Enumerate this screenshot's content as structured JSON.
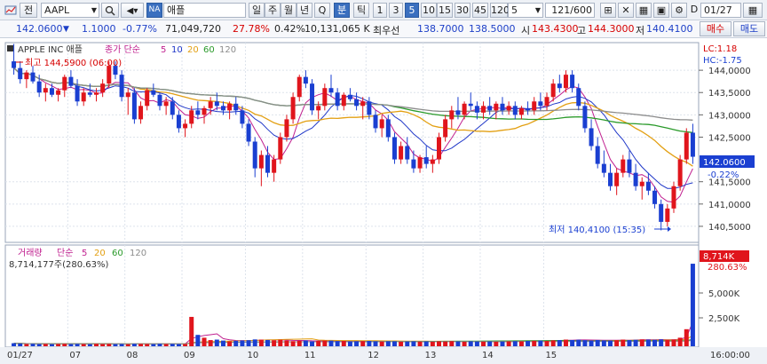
{
  "toolbar": {
    "mode_label": "전",
    "symbol": "AAPL",
    "market_badge": "NA",
    "stock_name": "애플",
    "periods": [
      "일",
      "주",
      "월",
      "년",
      "Q",
      "분",
      "틱"
    ],
    "active_period": "분",
    "intervals": [
      "1",
      "3",
      "5",
      "10",
      "15",
      "30",
      "45",
      "120"
    ],
    "active_interval": "5",
    "interval_select": "5",
    "bar_count": "121",
    "bar_total": "/600",
    "date_field": "01/27",
    "date_prefix": "D"
  },
  "quote": {
    "price": "142.0600",
    "change": "1.1000",
    "change_pct": "-0.77%",
    "volume": "71,049,720",
    "turnover_pct": "27.78%",
    "vol_ratio_pct": "0.42%",
    "amount": "10,131,065 K",
    "best_label": "최우선",
    "best_ask": "138.7000",
    "best_bid": "138.5000",
    "open_label": "시",
    "open": "143.4300",
    "high_label": "고",
    "high": "144.3000",
    "low_label": "저",
    "low": "140.4100",
    "buy_label": "매수",
    "sell_label": "매도"
  },
  "price_panel": {
    "title": "APPLE INC 애플",
    "ma_label": "종가 단순",
    "ma_periods": [
      "5",
      "10",
      "20",
      "60",
      "120"
    ],
    "high_annotation": "최고 144,5900 (06:00)",
    "low_annotation": "최저 140,4100 (15:35)",
    "lc": "LC:1.18",
    "hc": "HC:-1.75",
    "current_tag": "142.0600",
    "current_pct": "-0.22%",
    "y_ticks": [
      "144,0000",
      "143,5000",
      "143,0000",
      "142,5000",
      "141,5000",
      "141,0000",
      "140,5000"
    ]
  },
  "volume_panel": {
    "title": "거래량",
    "ma_label": "단순",
    "ma_periods": [
      "5",
      "20",
      "60",
      "120"
    ],
    "value": "8,714,177주(280.63%)",
    "tag_value": "8,714K",
    "tag_pct": "280.63%",
    "y_ticks": [
      "5,000K",
      "2,500K"
    ]
  },
  "x_axis": {
    "labels": [
      "01/27",
      "07",
      "08",
      "09",
      "10",
      "11",
      "12",
      "13",
      "14",
      "15"
    ],
    "right_label": "16:00:00"
  },
  "colors": {
    "up": "#e0151c",
    "down": "#1a3fd1",
    "ma5": "#c01f8f",
    "ma10": "#1f37c8",
    "ma20": "#e3a013",
    "ma60": "#2a9a2a",
    "ma120": "#8c8c8c"
  },
  "chart_data": {
    "type": "candlestick",
    "x_unit": "5-minute bars",
    "y_range": [
      140.2,
      144.5
    ],
    "ohlc": [
      [
        144.2,
        144.59,
        143.9,
        144.05
      ],
      [
        144.05,
        144.2,
        143.7,
        143.8
      ],
      [
        143.8,
        144.0,
        143.6,
        143.95
      ],
      [
        143.95,
        144.1,
        143.7,
        143.75
      ],
      [
        143.75,
        143.9,
        143.4,
        143.5
      ],
      [
        143.5,
        143.7,
        143.3,
        143.6
      ],
      [
        143.6,
        143.7,
        143.4,
        143.45
      ],
      [
        143.45,
        143.6,
        143.3,
        143.55
      ],
      [
        143.55,
        143.9,
        143.4,
        143.85
      ],
      [
        143.85,
        144.0,
        143.6,
        143.65
      ],
      [
        143.65,
        143.8,
        143.2,
        143.3
      ],
      [
        143.3,
        143.6,
        143.2,
        143.5
      ],
      [
        143.5,
        143.7,
        143.4,
        143.45
      ],
      [
        143.45,
        143.6,
        143.3,
        143.5
      ],
      [
        143.5,
        143.8,
        143.4,
        143.7
      ],
      [
        143.7,
        144.2,
        143.6,
        144.1
      ],
      [
        144.1,
        144.2,
        143.8,
        143.9
      ],
      [
        143.9,
        144.0,
        143.3,
        143.4
      ],
      [
        143.4,
        143.6,
        143.0,
        143.5
      ],
      [
        143.5,
        143.6,
        142.8,
        142.9
      ],
      [
        142.9,
        143.3,
        142.8,
        143.2
      ],
      [
        143.2,
        143.6,
        143.1,
        143.55
      ],
      [
        143.55,
        143.7,
        143.4,
        143.45
      ],
      [
        143.45,
        143.5,
        143.1,
        143.2
      ],
      [
        143.2,
        143.4,
        143.0,
        143.3
      ],
      [
        143.3,
        143.4,
        142.9,
        143.0
      ],
      [
        143.0,
        143.1,
        142.6,
        142.7
      ],
      [
        142.7,
        142.9,
        142.5,
        142.8
      ],
      [
        142.8,
        143.2,
        142.7,
        143.1
      ],
      [
        143.1,
        143.3,
        142.9,
        143.0
      ],
      [
        143.0,
        143.2,
        142.8,
        143.15
      ],
      [
        143.15,
        143.4,
        143.0,
        143.3
      ],
      [
        143.3,
        143.5,
        143.1,
        143.2
      ],
      [
        143.2,
        143.3,
        143.0,
        143.1
      ],
      [
        143.1,
        143.3,
        142.9,
        143.25
      ],
      [
        143.25,
        143.4,
        143.0,
        143.1
      ],
      [
        143.1,
        143.2,
        142.7,
        142.8
      ],
      [
        142.8,
        142.9,
        142.3,
        142.4
      ],
      [
        142.4,
        142.5,
        141.6,
        141.8
      ],
      [
        141.8,
        142.2,
        141.4,
        142.1
      ],
      [
        142.1,
        142.3,
        141.6,
        141.7
      ],
      [
        141.7,
        142.1,
        141.5,
        142.0
      ],
      [
        142.0,
        142.6,
        141.9,
        142.5
      ],
      [
        142.5,
        143.0,
        142.4,
        142.9
      ],
      [
        142.9,
        143.5,
        142.8,
        143.4
      ],
      [
        143.4,
        143.9,
        143.3,
        143.85
      ],
      [
        143.85,
        144.0,
        143.6,
        143.7
      ],
      [
        143.7,
        143.8,
        143.0,
        143.1
      ],
      [
        143.1,
        143.3,
        142.9,
        143.2
      ],
      [
        143.2,
        143.7,
        143.1,
        143.6
      ],
      [
        143.6,
        143.9,
        143.4,
        143.5
      ],
      [
        143.5,
        143.6,
        143.1,
        143.2
      ],
      [
        143.2,
        143.5,
        143.1,
        143.45
      ],
      [
        143.45,
        143.6,
        143.3,
        143.35
      ],
      [
        143.35,
        143.5,
        143.1,
        143.2
      ],
      [
        143.2,
        143.4,
        142.9,
        143.3
      ],
      [
        143.3,
        143.4,
        142.9,
        143.0
      ],
      [
        143.0,
        143.1,
        142.6,
        142.7
      ],
      [
        142.7,
        143.0,
        142.5,
        142.9
      ],
      [
        142.9,
        143.0,
        142.4,
        142.5
      ],
      [
        142.5,
        142.6,
        141.9,
        142.0
      ],
      [
        142.0,
        142.4,
        141.9,
        142.3
      ],
      [
        142.3,
        142.5,
        141.9,
        142.0
      ],
      [
        142.0,
        142.2,
        141.7,
        141.8
      ],
      [
        141.8,
        142.1,
        141.7,
        142.05
      ],
      [
        142.05,
        142.3,
        141.8,
        141.9
      ],
      [
        141.9,
        142.1,
        141.7,
        142.0
      ],
      [
        142.0,
        142.6,
        141.9,
        142.5
      ],
      [
        142.5,
        143.0,
        142.4,
        142.9
      ],
      [
        142.9,
        143.2,
        142.7,
        143.1
      ],
      [
        143.1,
        143.4,
        142.9,
        143.0
      ],
      [
        143.0,
        143.3,
        142.9,
        143.25
      ],
      [
        143.25,
        143.5,
        143.1,
        143.2
      ],
      [
        143.2,
        143.3,
        142.9,
        143.05
      ],
      [
        143.05,
        143.3,
        142.9,
        143.2
      ],
      [
        143.2,
        143.4,
        143.0,
        143.1
      ],
      [
        143.1,
        143.3,
        142.9,
        143.25
      ],
      [
        143.25,
        143.4,
        143.0,
        143.1
      ],
      [
        143.1,
        143.3,
        143.0,
        143.2
      ],
      [
        143.2,
        143.3,
        142.9,
        143.0
      ],
      [
        143.0,
        143.2,
        142.9,
        143.15
      ],
      [
        143.15,
        143.3,
        143.0,
        143.1
      ],
      [
        143.1,
        143.4,
        143.0,
        143.3
      ],
      [
        143.3,
        143.5,
        143.1,
        143.2
      ],
      [
        143.2,
        143.5,
        143.1,
        143.4
      ],
      [
        143.4,
        143.8,
        143.3,
        143.7
      ],
      [
        143.7,
        143.9,
        143.5,
        143.6
      ],
      [
        143.6,
        144.0,
        143.5,
        143.9
      ],
      [
        143.9,
        144.0,
        143.5,
        143.6
      ],
      [
        143.6,
        143.7,
        143.1,
        143.2
      ],
      [
        143.2,
        143.3,
        142.6,
        142.7
      ],
      [
        142.7,
        142.9,
        142.2,
        142.3
      ],
      [
        142.3,
        142.5,
        141.8,
        141.9
      ],
      [
        141.9,
        142.2,
        141.6,
        141.7
      ],
      [
        141.7,
        141.9,
        141.3,
        141.4
      ],
      [
        141.4,
        141.8,
        141.2,
        141.7
      ],
      [
        141.7,
        142.1,
        141.6,
        142.0
      ],
      [
        142.0,
        142.2,
        141.6,
        141.7
      ],
      [
        141.7,
        141.9,
        141.3,
        141.4
      ],
      [
        141.4,
        141.6,
        141.1,
        141.5
      ],
      [
        141.5,
        141.7,
        141.2,
        141.3
      ],
      [
        141.3,
        141.4,
        140.9,
        141.0
      ],
      [
        141.0,
        141.1,
        140.41,
        140.6
      ],
      [
        140.6,
        141.0,
        140.5,
        140.9
      ],
      [
        140.9,
        141.5,
        140.8,
        141.4
      ],
      [
        141.4,
        142.1,
        141.3,
        142.0
      ],
      [
        142.0,
        142.7,
        141.9,
        142.6
      ],
      [
        142.6,
        142.8,
        141.9,
        142.06
      ]
    ],
    "volume_k": [
      320,
      280,
      240,
      260,
      230,
      250,
      220,
      240,
      260,
      230,
      250,
      240,
      220,
      260,
      240,
      250,
      230,
      240,
      220,
      260,
      250,
      240,
      230,
      260,
      240,
      250,
      230,
      240,
      3100,
      1200,
      900,
      650,
      700,
      600,
      520,
      580,
      610,
      640,
      720,
      700,
      660,
      620,
      690,
      600,
      540,
      580,
      610,
      520,
      560,
      600,
      590,
      540,
      560,
      500,
      520,
      540,
      560,
      520,
      500,
      530,
      520,
      480,
      500,
      520,
      490,
      510,
      480,
      520,
      500,
      540,
      510,
      480,
      520,
      500,
      490,
      510,
      480,
      500,
      520,
      540,
      520,
      560,
      580,
      600,
      560,
      620,
      650,
      700,
      660,
      690,
      640,
      600,
      660,
      620,
      600,
      640,
      700,
      650,
      680,
      720,
      700,
      680,
      720,
      660,
      700,
      900,
      1800,
      8714
    ]
  }
}
